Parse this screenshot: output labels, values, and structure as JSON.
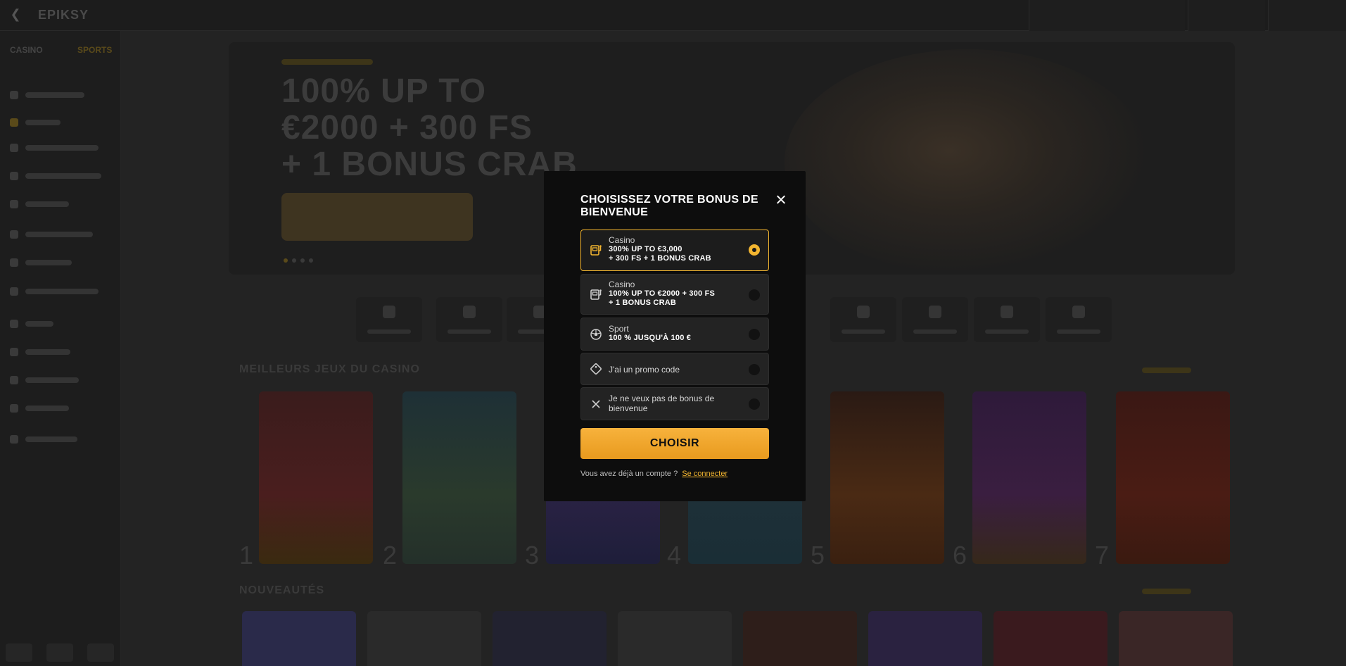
{
  "background": {
    "logo": "EPIKSY",
    "sidebar_tabs": [
      "CASINO",
      "SPORTS"
    ],
    "hero_title_lines": [
      "100% UP TO",
      "€2000 + 300 FS",
      "+ 1 BONUS CRAB"
    ],
    "section_top_games": "MEILLEURS JEUX DU CASINO",
    "section_new": "NOUVEAUTÉS",
    "ranks": [
      "1",
      "2",
      "3",
      "4",
      "5",
      "6",
      "7"
    ]
  },
  "modal": {
    "title": "CHOISISSEZ VOTRE BONUS DE BIENVENUE",
    "options": [
      {
        "label": "Casino",
        "value_line1": "300% UP TO €3,000",
        "value_line2": "+ 300 FS + 1 BONUS CRAB",
        "icon": "slot-machine-icon",
        "selected": true
      },
      {
        "label": "Casino",
        "value_line1": "100% UP TO €2000 + 300 FS",
        "value_line2": "+ 1 BONUS CRAB",
        "icon": "slot-machine-icon",
        "selected": false
      },
      {
        "label": "Sport",
        "value_line1": "100 % JUSQU'À 100 €",
        "icon": "soccer-ball-icon",
        "selected": false
      },
      {
        "text": "J'ai un promo code",
        "icon": "tag-icon",
        "selected": false
      },
      {
        "text_line1": "Je ne veux pas de bonus de",
        "text_line2": "bienvenue",
        "icon": "close-icon",
        "selected": false
      }
    ],
    "choose_button": "CHOISIR",
    "login_prompt": "Vous avez déjà un compte ?",
    "login_link": "Se connecter"
  },
  "colors": {
    "accent": "#f2b530",
    "modal_bg": "#0d0d0d",
    "option_bg": "#232323",
    "overlay_bg": "#1a1a1a"
  }
}
